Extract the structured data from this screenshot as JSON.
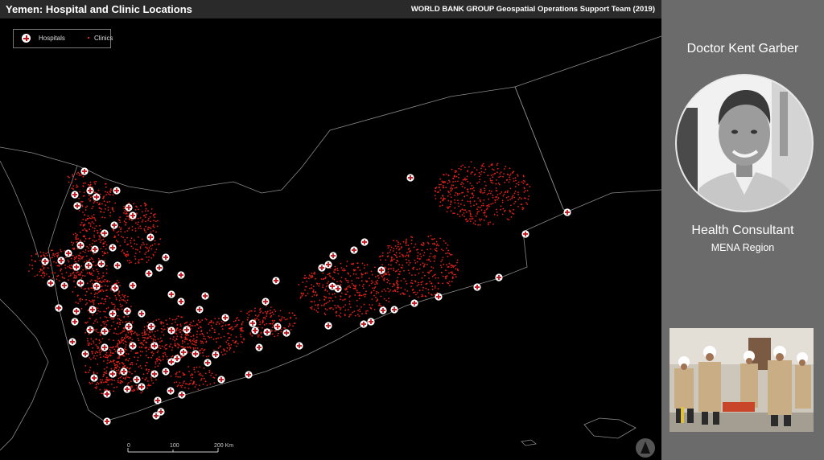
{
  "map": {
    "title": "Yemen: Hospital and Clinic Locations",
    "credit": "WORLD BANK GROUP Geospatial Operations Support Team (2019)",
    "legend": {
      "hospitals_label": "Hospitals",
      "clinics_label": "Clinics"
    },
    "scale": {
      "tick_0": "0",
      "tick_100": "100",
      "tick_200": "200 Km"
    },
    "colors": {
      "background": "#000000",
      "boundary": "#8a8a8a",
      "hospital_fill": "#ffffff",
      "hospital_cross": "#c0121a",
      "clinic": "#e32018",
      "titlebar": "#2a2a2a"
    },
    "north_arrow_icon": "north-arrow-icon"
  },
  "profile": {
    "name": "Doctor Kent Garber",
    "role": "Health Consultant",
    "region": "MENA Region",
    "panel_color": "#6b6b6b"
  }
}
